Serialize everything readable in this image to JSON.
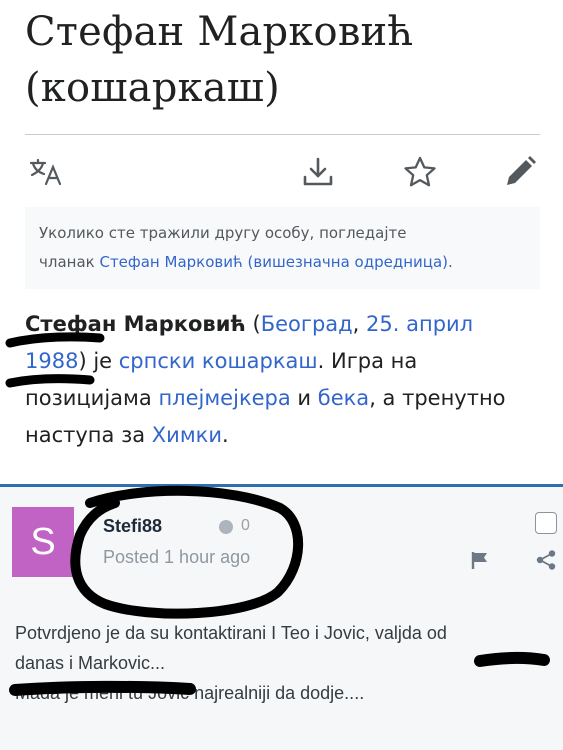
{
  "wiki": {
    "title_line1": "Стефан Марковић",
    "title_line2": "(кошаркаш)",
    "actions": {
      "language_icon": "translate-icon",
      "download_icon": "download-icon",
      "watch_icon": "star-icon",
      "edit_icon": "pencil-icon"
    },
    "hatnote": {
      "line1": "Уколико сте тражили другу особу, погледајте",
      "prefix": "чланак ",
      "link": "Стефан Марковић (вишезначна одредница)",
      "suffix": "."
    },
    "lead": {
      "name": "Стефан Марковић",
      "open_paren": " (",
      "birthplace": "Београд",
      "comma": ", ",
      "birthdate": "25. април",
      "year": "1988",
      "close": ") је ",
      "nationality": "српски кошаркаш",
      "text1": ". Игра на позицијама ",
      "position1": "плејмејкера",
      "text2": " и ",
      "position2": "бека",
      "text3": ", а тренутно наступа за ",
      "club": "Химки",
      "text4": "."
    }
  },
  "forum": {
    "avatar_letter": "S",
    "avatar_color": "#c162c5",
    "username": "Stefi88",
    "reputation": "0",
    "posted": "Posted 1 hour ago",
    "post_lines": [
      "Potvrdjeno je da su kontaktirani I Teo i Jovic, valjda od",
      "danas i Markovic...",
      "Mada je meni tu Jovic najrealniji da dodje...."
    ]
  }
}
